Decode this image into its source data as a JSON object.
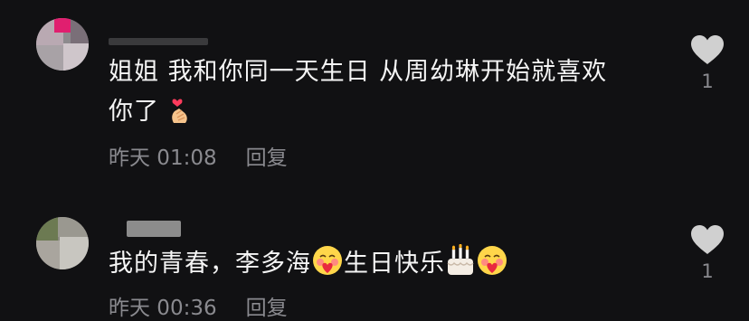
{
  "comments": [
    {
      "text_line1": "姐姐 我和你同一天生日 从周幼琳开始就喜欢",
      "text_line2": "你了",
      "emoji_after": "hand-heart-emoji",
      "time": "昨天 01:08",
      "reply_label": "回复",
      "like_count": "1"
    },
    {
      "text_part1": "我的青春，李多海",
      "text_part2": "生日快乐",
      "emojis": [
        "blush-heart-emoji",
        "birthday-cake-emoji",
        "blush-heart-emoji"
      ],
      "time": "昨天 00:36",
      "reply_label": "回复",
      "like_count": "1"
    }
  ],
  "colors": {
    "background": "#111113",
    "text": "#f5f5f5",
    "meta": "#8a8a8f",
    "heart": "#d0d0d0"
  }
}
